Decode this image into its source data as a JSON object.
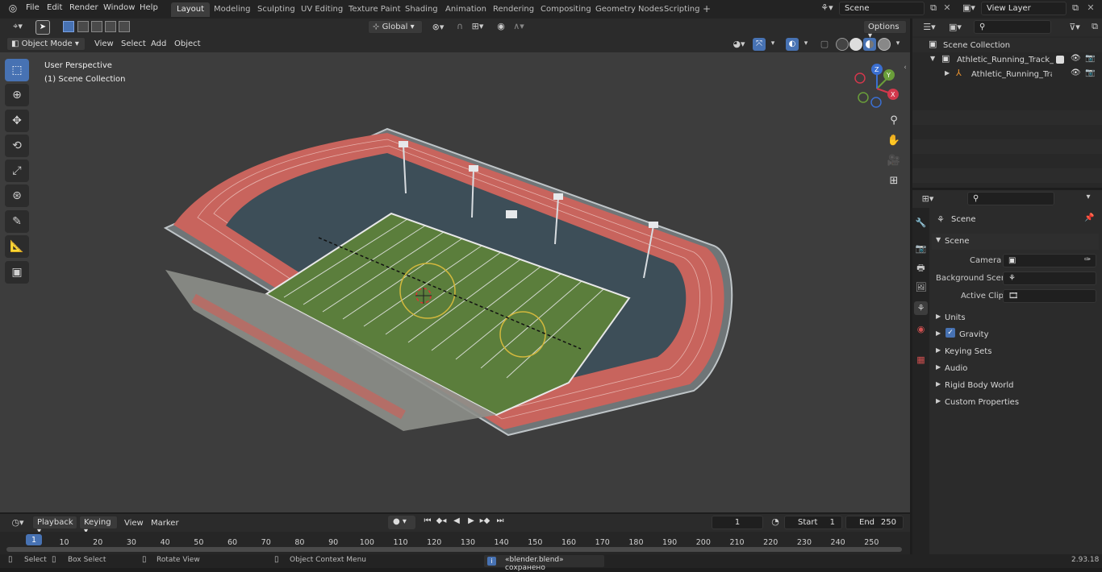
{
  "menu": [
    "File",
    "Edit",
    "Render",
    "Window",
    "Help"
  ],
  "workspaces": [
    "Layout",
    "Modeling",
    "Sculpting",
    "UV Editing",
    "Texture Paint",
    "Shading",
    "Animation",
    "Rendering",
    "Compositing",
    "Geometry Nodes",
    "Scripting"
  ],
  "scene_field": "Scene",
  "view_layer_field": "View Layer",
  "viewport_header": {
    "mode": "Object Mode",
    "menus": [
      "View",
      "Select",
      "Add",
      "Object"
    ],
    "transform_orientation": "Global",
    "options": "Options"
  },
  "viewport_overlay": {
    "line1": "User Perspective",
    "line2": "(1) Scene Collection"
  },
  "gizmo": {
    "x": "X",
    "y": "Y",
    "z": "Z"
  },
  "outliner": {
    "collection": "Scene Collection",
    "items": [
      "Athletic_Running_Track_Stadi",
      "Athletic_Running_Track_S"
    ]
  },
  "properties": {
    "title": "Scene",
    "section": "Scene",
    "fields": [
      {
        "label": "Camera",
        "value": ""
      },
      {
        "label": "Background Scene",
        "value": ""
      },
      {
        "label": "Active Clip",
        "value": ""
      }
    ],
    "panels": [
      "Units",
      "Gravity",
      "Keying Sets",
      "Audio",
      "Rigid Body World",
      "Custom Properties"
    ]
  },
  "timeline": {
    "menus": [
      "Playback",
      "Keying",
      "View",
      "Marker"
    ],
    "current_frame": "1",
    "start_label": "Start",
    "start_value": "1",
    "end_label": "End",
    "end_value": "250",
    "ticks": [
      "1",
      "10",
      "20",
      "30",
      "40",
      "50",
      "60",
      "70",
      "80",
      "90",
      "100",
      "110",
      "120",
      "130",
      "140",
      "150",
      "160",
      "170",
      "180",
      "190",
      "200",
      "210",
      "220",
      "230",
      "240",
      "250"
    ]
  },
  "status_bar": {
    "select": "Select",
    "box_select": "Box Select",
    "rotate_view": "Rotate View",
    "context_menu": "Object Context Menu",
    "message": "«blender.blend» сохранено",
    "version": "2.93.18"
  },
  "colors": {
    "accent": "#4772b3",
    "track": "#c8645d",
    "field": "#5b7e3c",
    "viewport_bg": "#3d3d3d"
  }
}
